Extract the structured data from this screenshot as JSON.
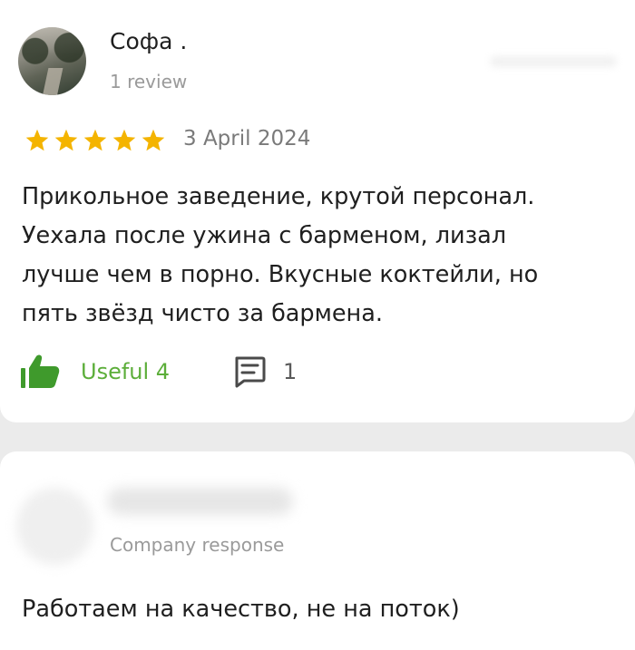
{
  "review": {
    "author_name": "Софа .",
    "author_meta": "1 review",
    "rating": 5,
    "rating_max": 5,
    "date": "3 April 2024",
    "text_lines": [
      "Прикольное заведение, крутой персонал.",
      "Уехала после ужина с барменом, лизал",
      "лучше чем в порно. Вкусные коктейли, но",
      "пять звёзд чисто за бармена."
    ],
    "useful_label": "Useful 4",
    "comments_count": "1"
  },
  "response": {
    "label": "Company response",
    "text": "Работаем на качество, не на поток)"
  },
  "colors": {
    "star": "#f4b400",
    "useful_green": "#5cae3a",
    "text": "#1f1f1f",
    "muted": "#9a9a9a",
    "background": "#ebebeb"
  },
  "icons": {
    "avatar": "user-avatar",
    "star": "star-icon",
    "like": "thumbs-up-icon",
    "comment": "comment-icon"
  }
}
